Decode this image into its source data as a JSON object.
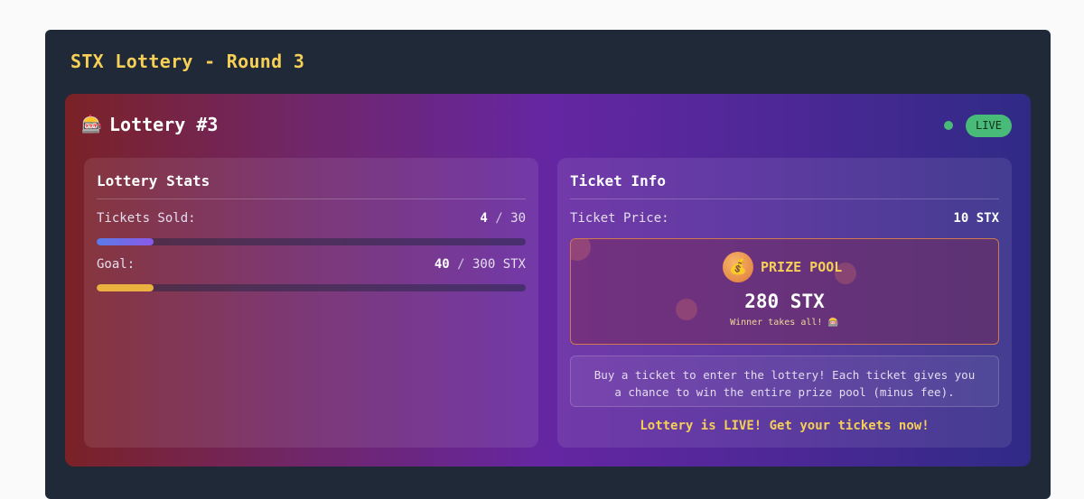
{
  "app": {
    "title": "STX Lottery - Round 3"
  },
  "lottery": {
    "icon": "slot-machine-icon",
    "icon_glyph": "🎰",
    "title": "Lottery #3",
    "status": "LIVE"
  },
  "stats": {
    "title": "Lottery Stats",
    "tickets_label": "Tickets Sold:",
    "tickets_sold": "4",
    "tickets_total": "30",
    "tickets_fraction": 0.133,
    "goal_label": "Goal:",
    "goal_current": "40",
    "goal_total": "300 STX",
    "goal_fraction": 0.133,
    "separator": "/"
  },
  "ticket": {
    "title": "Ticket Info",
    "price_label": "Ticket Price:",
    "price_value": "10 STX",
    "prize_icon": "money-bag-icon",
    "prize_glyph": "💰",
    "prize_label": "PRIZE POOL",
    "prize_amount": "280 STX",
    "prize_sub": "Winner takes all! 🎰",
    "info_text": "Buy a ticket to enter the lottery! Each ticket gives you a chance to win the entire prize pool (minus fee).",
    "live_message": "Lottery is LIVE! Get your tickets now!"
  },
  "colors": {
    "accent_yellow": "#f6cf57",
    "live_green": "#48bb78",
    "panel_bg": "#1f2937"
  }
}
